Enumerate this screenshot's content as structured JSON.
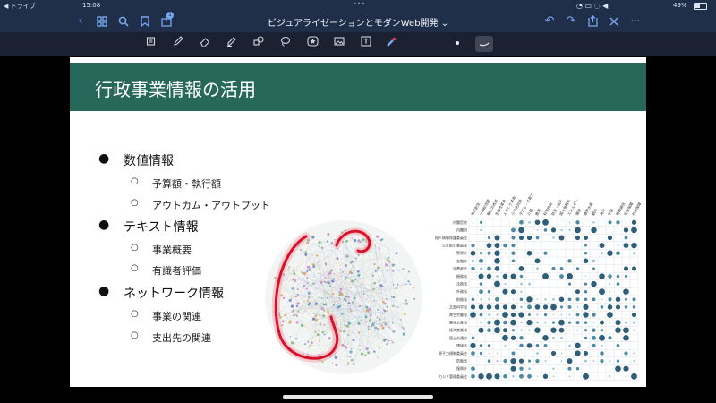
{
  "status": {
    "left": "◀ ドライブ",
    "time": "15:08",
    "battery": "49%"
  },
  "header": {
    "title": "ビジュアライゼーションとモダンWeb開発 ⌄",
    "badge": "1"
  },
  "slide": {
    "title": "行政事業情報の活用",
    "bullets": [
      {
        "label": "数値情報",
        "subs": [
          "予算額・執行額",
          "アウトカム・アウトプット"
        ]
      },
      {
        "label": "テキスト情報",
        "subs": [
          "事業概要",
          "有識者評価"
        ]
      },
      {
        "label": "ネットワーク情報",
        "subs": [
          "事業の関連",
          "支出先の関連"
        ]
      }
    ]
  },
  "bubble_matrix": {
    "row_labels": [
      "内閣官房",
      "内閣府",
      "個人情報保護委員会",
      "公正取引委員会",
      "警察庁",
      "金融庁",
      "消費者庁",
      "総務省",
      "法務省",
      "外務省",
      "財務省",
      "文部科学省",
      "厚生労働省",
      "農林水産省",
      "経済産業省",
      "国土交通省",
      "環境省",
      "原子力規制委員会",
      "防衛省",
      "復興庁",
      "カジノ管理委員会"
    ],
    "col_labels": [
      "地方創生",
      "一億総活躍",
      "働き方改革",
      "生産性革命",
      "人づくり革命",
      "少子化対策",
      "子ども・子育て",
      "介護",
      "教育",
      "科学技術",
      "防災・減災",
      "国土強靱化",
      "エネルギー",
      "環境",
      "農林水産",
      "観光",
      "海洋",
      "宇宙",
      "情報通信",
      "安全保障",
      "社会保障"
    ]
  },
  "colors": {
    "banner": "#28685a",
    "accent": "#7aa7ee",
    "highlight": "#d8102a",
    "bubble": "#3d6f85"
  }
}
